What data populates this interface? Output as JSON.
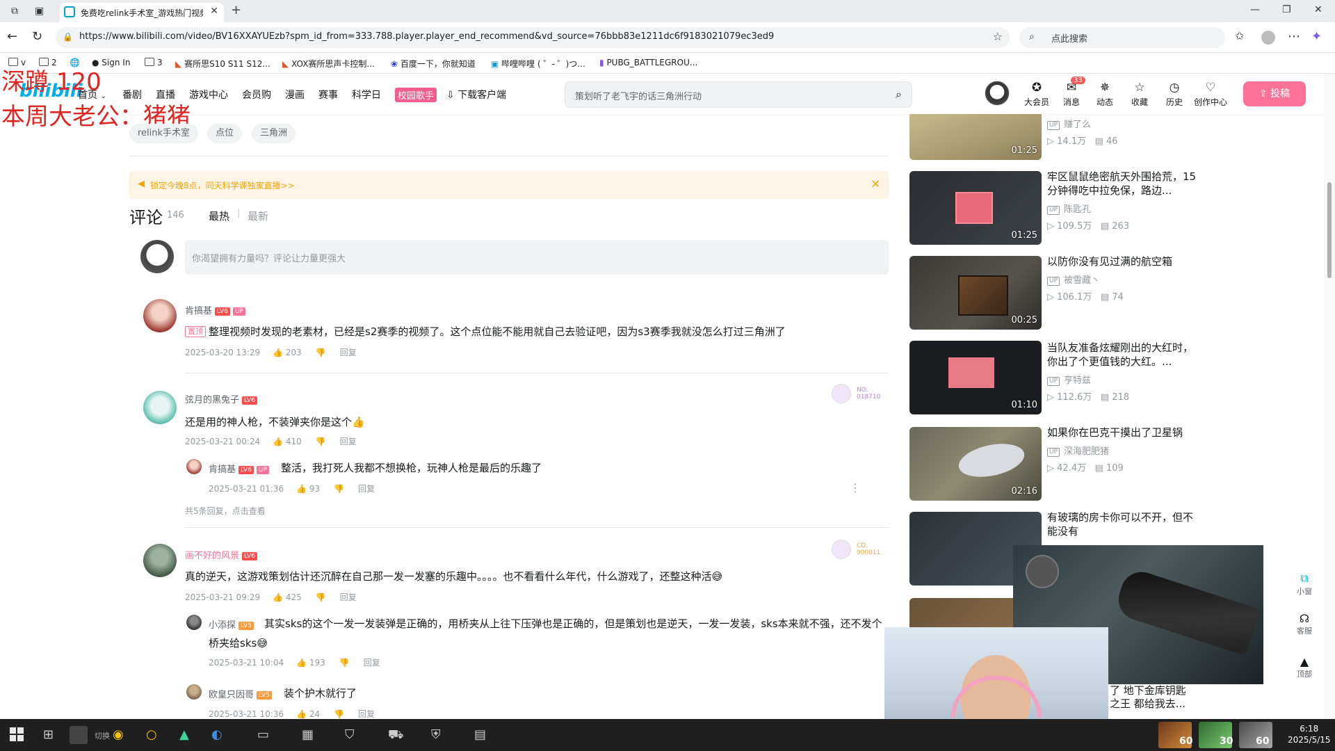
{
  "browser": {
    "tab_title": "免费吃relink手术室_游戏热门视频",
    "url": "https://www.bilibili.com/video/BV16XXAYUEzb?spm_id_from=333.788.player.player_end_recommend&vd_source=76bbb83e1211dc6f9183021079ec3ed9",
    "search_placeholder": "点此搜索",
    "bookmarks": [
      "v",
      "2",
      "Sign In",
      "3",
      "赛所思S10 S11 S12...",
      "XOX赛所思声卡控制...",
      "百度一下，你就知道",
      "哔哩哔哩 ( ゜- ゜)つ...",
      "PUBG_BATTLEGROU..."
    ]
  },
  "overlay": {
    "line1": "深蹲 120",
    "line2": "本周大老公：猪猪"
  },
  "header": {
    "logo": "bilibili",
    "nav": [
      "首页",
      "番剧",
      "直播",
      "游戏中心",
      "会员购",
      "漫画",
      "赛事",
      "科学日"
    ],
    "campus_badge": "校园歌手",
    "download": "下载客户端",
    "search_placeholder": "策划听了老飞宇的话三角洲行动",
    "icons": [
      {
        "label": "大会员",
        "icon": "vip-icon"
      },
      {
        "label": "消息",
        "icon": "message-icon"
      },
      {
        "label": "动态",
        "icon": "dynamic-icon"
      },
      {
        "label": "收藏",
        "icon": "favorite-icon"
      },
      {
        "label": "历史",
        "icon": "history-icon"
      },
      {
        "label": "创作中心",
        "icon": "creator-icon"
      }
    ],
    "message_count": "33",
    "upload": "投稿"
  },
  "tags": [
    "relink手术室",
    "点位",
    "三角洲"
  ],
  "notice": "锁定今晚8点，同天科学课独家直播>>",
  "comments": {
    "title": "评论",
    "count": "146",
    "sort_hot": "最热",
    "sort_sep": "|",
    "sort_new": "最新",
    "reply_placeholder": "你渴望拥有力量吗？评论让力量更强大",
    "reply_label": "回复",
    "items": [
      {
        "user": "肯搞基",
        "level": "LV6",
        "up": "UP",
        "pinned": "置顶",
        "text": "整理视频时发现的老素材，已经是s2赛季的视频了。这个点位能不能用就自己去验证吧，因为s3赛季我就没怎么打过三角洲了",
        "time": "2025-03-20 13:29",
        "likes": "203"
      },
      {
        "user": "弦月的黑兔子",
        "level": "LV6",
        "fan_no": "NO.",
        "fan_id": "018710",
        "text": "还是用的神人枪，不装弹夹你是这个👍",
        "time": "2025-03-21 00:24",
        "likes": "410",
        "replies": [
          {
            "user": "肯搞基",
            "level": "LV6",
            "up": "UP",
            "text": "整活，我打死人我都不想换枪，玩神人枪是最后的乐趣了",
            "time": "2025-03-21 01:36",
            "likes": "93"
          }
        ],
        "more": "共5条回复，点击查看"
      },
      {
        "user": "画不好的风景",
        "level": "LV6",
        "fan_no": "CD.",
        "fan_id": "000011",
        "text": "真的逆天，这游戏策划估计还沉醉在自己那一发一发塞的乐趣中。。。。也不看看什么年代，什么游戏了，还整这种活😅",
        "time": "2025-03-21 09:29",
        "likes": "425",
        "replies": [
          {
            "user": "小添探",
            "level": "LV5",
            "text_line1": "其实sks的这个一发一发装弹是正确的，用桥夹从上往下压弹也是正确的，但是策划也是逆天，一发一发装，sks本来就不强，还不发个",
            "text_line2": "桥夹给sks😅",
            "time": "2025-03-21 10:04",
            "likes": "193"
          },
          {
            "user": "欧皇只因哥",
            "level": "LV5",
            "text": "装个护木就行了",
            "time": "2025-03-21 10:36",
            "likes": "24"
          }
        ]
      }
    ]
  },
  "recommend": [
    {
      "title": "",
      "up": "赚了么",
      "views": "14.1万",
      "danmaku": "46",
      "duration": "01:25"
    },
    {
      "title": "牢区鼠鼠绝密航天外围拾荒，15分钟得吃中拉免保，路边...",
      "up": "陈匙孔",
      "views": "109.5万",
      "danmaku": "263",
      "duration": "01:25"
    },
    {
      "title": "以防你没有见过满的航空箱",
      "up": "被雪藏丶",
      "views": "106.1万",
      "danmaku": "74",
      "duration": "00:25"
    },
    {
      "title": "当队友准备炫耀刚出的大红时，你出了个更值钱的大红。...",
      "up": "亨特兹",
      "views": "112.6万",
      "danmaku": "218",
      "duration": "01:10"
    },
    {
      "title": "如果你在巴克干摸出了卫星锅",
      "up": "深海肥肥猪",
      "views": "42.4万",
      "danmaku": "109",
      "duration": "02:16"
    },
    {
      "title": "有玻璃的房卡你可以不开，但不能没有",
      "up": "",
      "views": "",
      "danmaku": "",
      "duration": ""
    }
  ],
  "rec_under_text": "了 地下金库钥匙之王 都给我去...",
  "side_buttons": [
    "小窗",
    "客服",
    "顶部"
  ],
  "taskbar": {
    "time": "6:18",
    "date": "2025/5/15",
    "tray_nums": [
      "60",
      "30",
      "60"
    ],
    "task_label": "切换"
  }
}
